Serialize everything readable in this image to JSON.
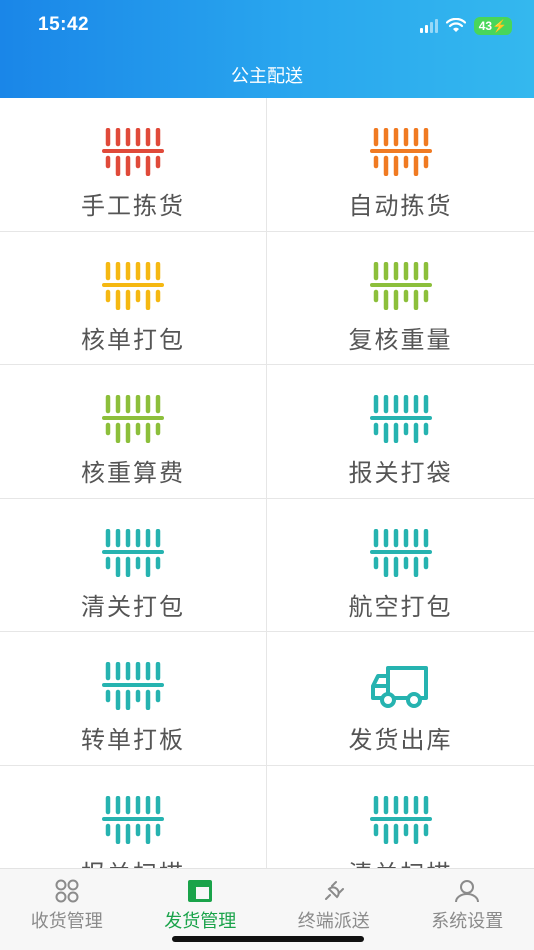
{
  "status": {
    "time": "15:42",
    "battery": "43"
  },
  "header": {
    "title": "公主配送"
  },
  "colors": {
    "red": "#e04a3a",
    "orange": "#f07a22",
    "yellow": "#f5b812",
    "green": "#8cbf3b",
    "teal": "#26b3b0",
    "active_tab": "#1aa34a"
  },
  "menu": [
    {
      "label": "手工拣货",
      "icon": "barcode-icon",
      "color": "#e04a3a"
    },
    {
      "label": "自动拣货",
      "icon": "barcode-icon",
      "color": "#f07a22"
    },
    {
      "label": "核单打包",
      "icon": "barcode-icon",
      "color": "#f5b812"
    },
    {
      "label": "复核重量",
      "icon": "barcode-icon",
      "color": "#8cbf3b"
    },
    {
      "label": "核重算费",
      "icon": "barcode-icon",
      "color": "#8cbf3b"
    },
    {
      "label": "报关打袋",
      "icon": "barcode-icon",
      "color": "#26b3b0"
    },
    {
      "label": "清关打包",
      "icon": "barcode-icon",
      "color": "#26b3b0"
    },
    {
      "label": "航空打包",
      "icon": "barcode-icon",
      "color": "#26b3b0"
    },
    {
      "label": "转单打板",
      "icon": "barcode-icon",
      "color": "#26b3b0"
    },
    {
      "label": "发货出库",
      "icon": "truck-icon",
      "color": "#26b3b0"
    },
    {
      "label": "报关扫描",
      "icon": "barcode-icon",
      "color": "#26b3b0"
    },
    {
      "label": "清关扫描",
      "icon": "barcode-icon",
      "color": "#26b3b0"
    }
  ],
  "tabs": [
    {
      "label": "收货管理",
      "icon": "grid-icon",
      "active": false
    },
    {
      "label": "发货管理",
      "icon": "layout-icon",
      "active": true
    },
    {
      "label": "终端派送",
      "icon": "plug-icon",
      "active": false
    },
    {
      "label": "系统设置",
      "icon": "user-icon",
      "active": false
    }
  ]
}
